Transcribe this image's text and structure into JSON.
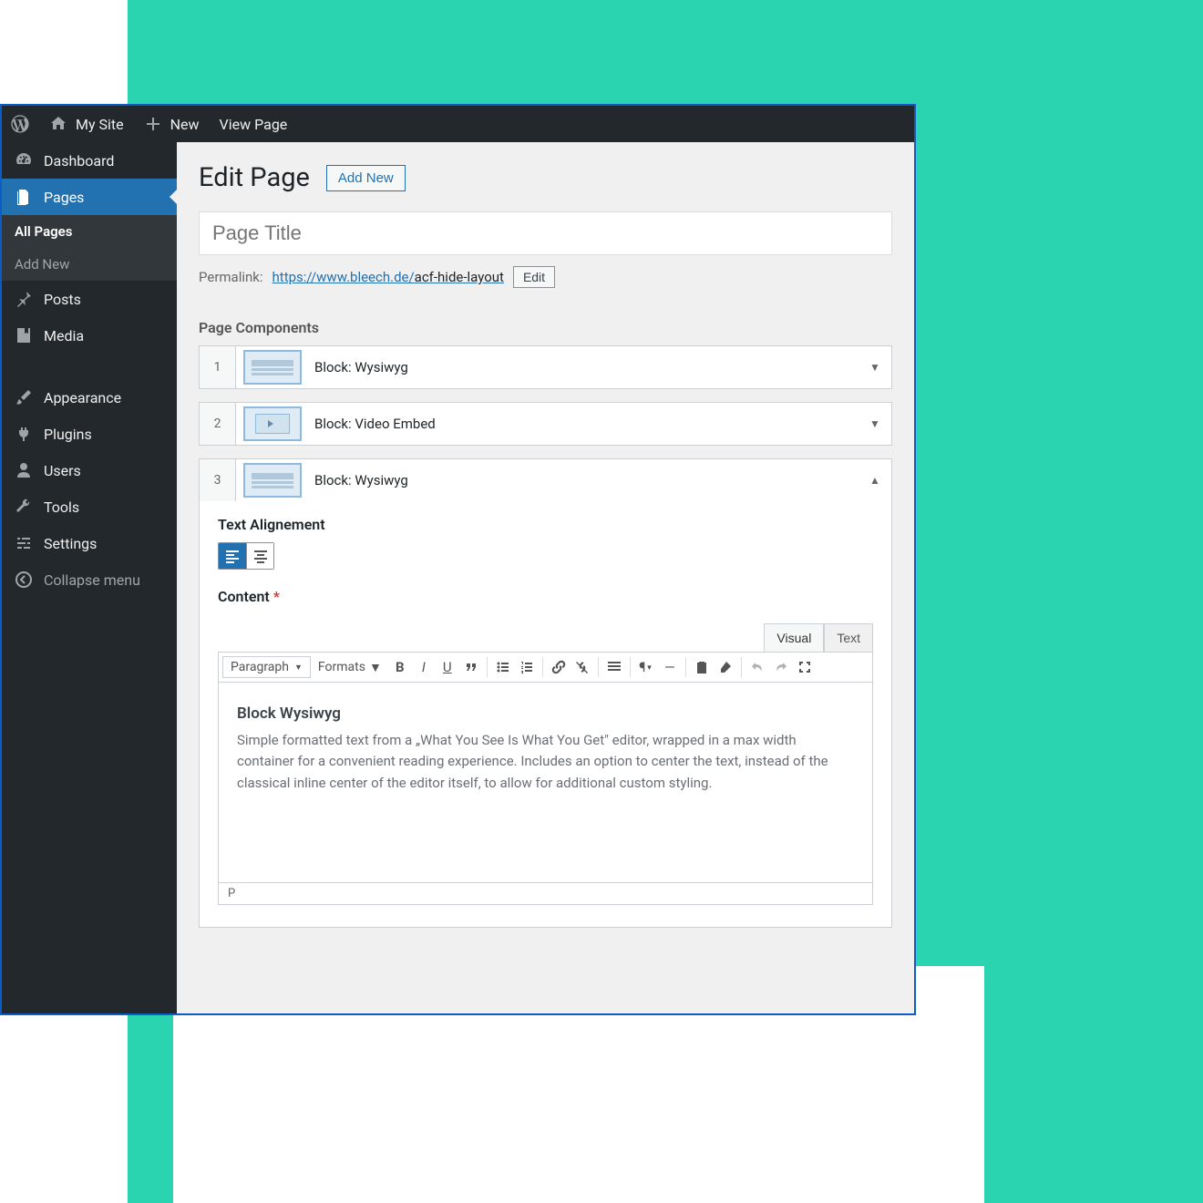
{
  "admin_bar": {
    "site": "My Site",
    "new": "New",
    "view": "View Page"
  },
  "sidebar": {
    "items": [
      {
        "label": "Dashboard"
      },
      {
        "label": "Pages"
      },
      {
        "label": "Posts"
      },
      {
        "label": "Media"
      },
      {
        "label": "Appearance"
      },
      {
        "label": "Plugins"
      },
      {
        "label": "Users"
      },
      {
        "label": "Tools"
      },
      {
        "label": "Settings"
      },
      {
        "label": "Collapse menu"
      }
    ],
    "submenu": {
      "all": "All Pages",
      "add": "Add New"
    }
  },
  "page": {
    "heading": "Edit Page",
    "add_new": "Add New",
    "title_placeholder": "Page Title",
    "permalink_label": "Permalink:",
    "permalink_base": "https://www.bleech.de/",
    "permalink_slug": "acf-hide-layout",
    "permalink_edit": "Edit"
  },
  "components": {
    "section_label": "Page Components",
    "rows": [
      {
        "num": "1",
        "label": "Block: Wysiwyg"
      },
      {
        "num": "2",
        "label": "Block: Video Embed"
      },
      {
        "num": "3",
        "label": "Block: Wysiwyg"
      }
    ]
  },
  "expanded": {
    "text_align_label": "Text Alignement",
    "content_label": "Content",
    "tabs": {
      "visual": "Visual",
      "text": "Text"
    },
    "toolbar": {
      "paragraph": "Paragraph",
      "formats": "Formats"
    },
    "body": {
      "heading": "Block Wysiwyg",
      "text": "Simple formatted text from a „What You See Is What You Get\" editor, wrapped in a max width container for a convenient reading experience. Includes an option to center the text, instead of the classical inline center of the editor itself, to allow for additional custom styling."
    },
    "status": "P"
  }
}
